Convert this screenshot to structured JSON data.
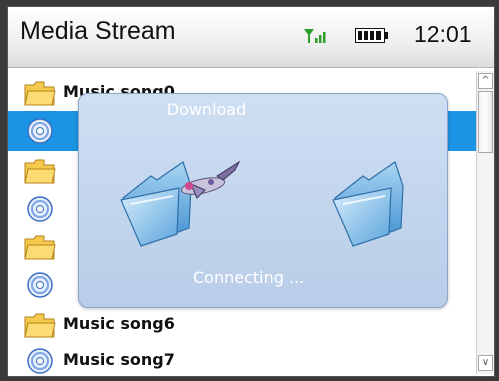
{
  "header": {
    "title": "Media Stream",
    "clock": "12:01",
    "signal_icon": "signal-strength-icon",
    "battery_icon": "battery-full-icon",
    "accent_signal": "#2aa02a"
  },
  "list": {
    "items": [
      {
        "type": "folder",
        "label": "Music song0",
        "icon": "folder-icon"
      },
      {
        "type": "disc",
        "label": "",
        "icon": "disc-icon",
        "selected": true
      },
      {
        "type": "folder",
        "label": "",
        "icon": "folder-icon"
      },
      {
        "type": "disc",
        "label": "",
        "icon": "disc-icon"
      },
      {
        "type": "folder",
        "label": "",
        "icon": "folder-icon"
      },
      {
        "type": "disc",
        "label": "",
        "icon": "disc-icon"
      },
      {
        "type": "folder",
        "label": "Music song6",
        "icon": "folder-icon"
      },
      {
        "type": "disc",
        "label": "Music song7",
        "icon": "disc-icon"
      }
    ],
    "selected_color": "#1b95e3"
  },
  "dialog": {
    "title": "Download",
    "status": "Connecting ..."
  }
}
